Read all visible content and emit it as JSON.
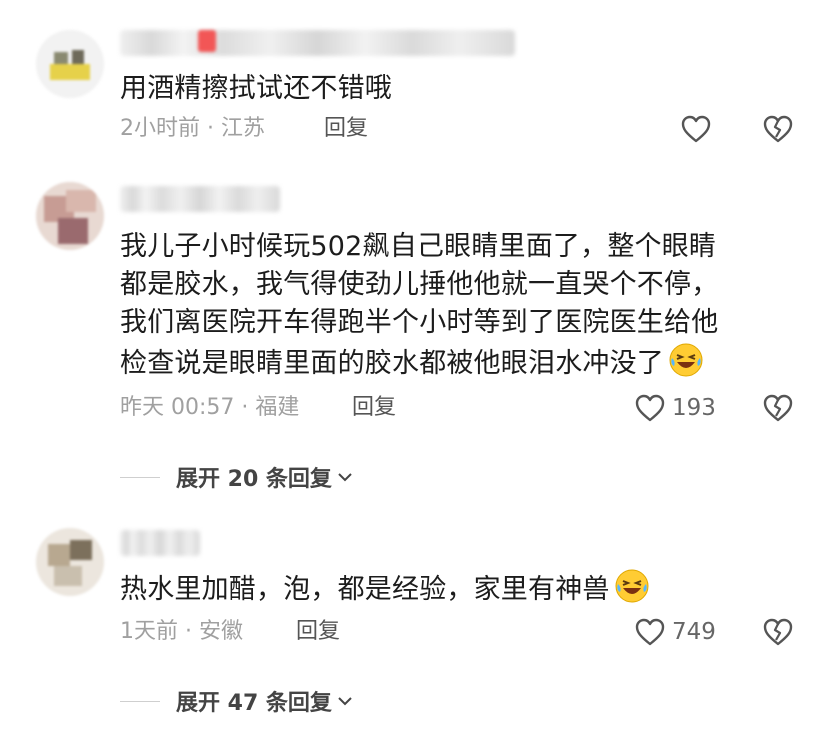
{
  "comments": [
    {
      "text": "用酒精擦拭试还不错哦",
      "time": "2小时前 · 江苏",
      "reply_label": "回复",
      "like_count": ""
    },
    {
      "text_lines": [
        "我儿子小时候玩502飙自己眼睛里面了，整个眼睛",
        "都是胶水，我气得使劲儿捶他他就一直哭个不停，",
        "我们离医院开车得跑半个小时等到了医院医生给他",
        "检查说是眼睛里面的胶水都被他眼泪水冲没了"
      ],
      "emoji": "laughing-tears-emoji",
      "time": "昨天 00:57 · 福建",
      "reply_label": "回复",
      "like_count": "193",
      "expand_label": "展开 20 条回复"
    },
    {
      "text": "热水里加醋，泡，都是经验，家里有神兽",
      "emoji": "laughing-tears-emoji",
      "time": "1天前 · 安徽",
      "reply_label": "回复",
      "like_count": "749",
      "expand_label": "展开 47 条回复"
    }
  ],
  "icons": {
    "like": "heart-outline-icon",
    "dislike": "broken-heart-icon",
    "expand": "chevron-down-icon"
  },
  "colors": {
    "text": "#1c1c1c",
    "meta": "#a0a0a0",
    "icon": "#555555"
  }
}
